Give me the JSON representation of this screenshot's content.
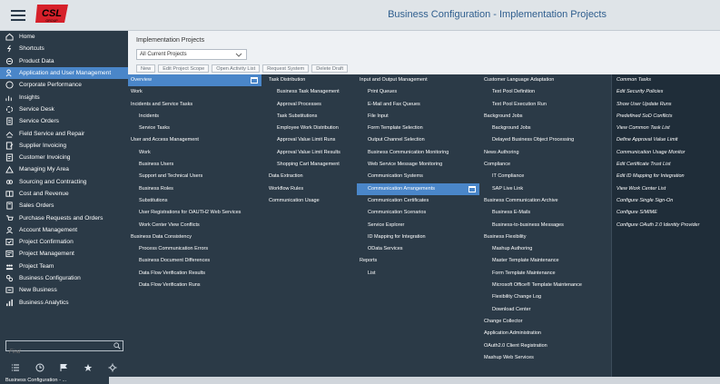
{
  "header": {
    "title": "Business Configuration - Implementation Projects",
    "logo_text": "CSL",
    "logo_sub": "GROUP"
  },
  "sidebar": {
    "items": [
      {
        "label": "Home",
        "icon": "home-icon"
      },
      {
        "label": "Shortcuts",
        "icon": "shortcut-icon"
      },
      {
        "label": "Product Data",
        "icon": "product-icon"
      },
      {
        "label": "Application and User Management",
        "icon": "user-settings-icon"
      },
      {
        "label": "Corporate Performance",
        "icon": "performance-icon"
      },
      {
        "label": "Insights",
        "icon": "insights-icon"
      },
      {
        "label": "Service Desk",
        "icon": "service-desk-icon"
      },
      {
        "label": "Service Orders",
        "icon": "service-orders-icon"
      },
      {
        "label": "Field Service and Repair",
        "icon": "field-service-icon"
      },
      {
        "label": "Supplier Invoicing",
        "icon": "supplier-invoice-icon"
      },
      {
        "label": "Customer Invoicing",
        "icon": "customer-invoice-icon"
      },
      {
        "label": "Managing My Area",
        "icon": "managing-area-icon"
      },
      {
        "label": "Sourcing and Contracting",
        "icon": "sourcing-icon"
      },
      {
        "label": "Cost and Revenue",
        "icon": "cost-revenue-icon"
      },
      {
        "label": "Sales Orders",
        "icon": "sales-orders-icon"
      },
      {
        "label": "Purchase Requests and Orders",
        "icon": "purchase-icon"
      },
      {
        "label": "Account Management",
        "icon": "account-icon"
      },
      {
        "label": "Project Confirmation",
        "icon": "project-confirmation-icon"
      },
      {
        "label": "Project Management",
        "icon": "project-management-icon"
      },
      {
        "label": "Project Team",
        "icon": "project-team-icon"
      },
      {
        "label": "Business Configuration",
        "icon": "business-config-icon"
      },
      {
        "label": "New Business",
        "icon": "new-business-icon"
      },
      {
        "label": "Business Analytics",
        "icon": "analytics-icon"
      }
    ],
    "find_placeholder": "Find",
    "bottom_icons": [
      "list-icon",
      "clock-icon",
      "flag-icon",
      "star-icon",
      "settings-icon"
    ]
  },
  "page": {
    "title": "Implementation Projects",
    "select_value": "All Current Projects",
    "toolbar": [
      "New",
      "Edit Project Scope",
      "Open Activity List",
      "Request System",
      "Delete Draft"
    ]
  },
  "menu": {
    "col1": [
      {
        "label": "Overview",
        "type": "head",
        "hl": true,
        "pop": true
      },
      {
        "label": "Work",
        "type": "head"
      },
      {
        "label": "Incidents and Service Tasks",
        "type": "head"
      },
      {
        "label": "Incidents",
        "type": "sub"
      },
      {
        "label": "Service Tasks",
        "type": "sub"
      },
      {
        "label": "User and Access Management",
        "type": "head"
      },
      {
        "label": "Work",
        "type": "sub"
      },
      {
        "label": "Business Users",
        "type": "sub"
      },
      {
        "label": "Support and Technical Users",
        "type": "sub"
      },
      {
        "label": "Business Roles",
        "type": "sub"
      },
      {
        "label": "Substitutions",
        "type": "sub"
      },
      {
        "label": "User Registrations for OAUTH2 Web Services",
        "type": "sub"
      },
      {
        "label": "Work Center View Conflicts",
        "type": "sub"
      },
      {
        "label": "Business Data Consistency",
        "type": "head"
      },
      {
        "label": "Process Communication Errors",
        "type": "sub"
      },
      {
        "label": "Business Document Differences",
        "type": "sub"
      },
      {
        "label": "Data Flow Verification Results",
        "type": "sub"
      },
      {
        "label": "Data Flow Verification Runs",
        "type": "sub"
      }
    ],
    "col2": [
      {
        "label": "Task Distribution",
        "type": "head"
      },
      {
        "label": "Business Task Management",
        "type": "sub"
      },
      {
        "label": "Approval Processes",
        "type": "sub"
      },
      {
        "label": "Task Substitutions",
        "type": "sub"
      },
      {
        "label": "Employee Work Distribution",
        "type": "sub"
      },
      {
        "label": "Approval Value Limit Runs",
        "type": "sub"
      },
      {
        "label": "Approval Value Limit Results",
        "type": "sub"
      },
      {
        "label": "Shopping Cart Management",
        "type": "sub"
      },
      {
        "label": "Data Extraction",
        "type": "head"
      },
      {
        "label": "Workflow Rules",
        "type": "head"
      },
      {
        "label": "Communication Usage",
        "type": "head"
      }
    ],
    "col3": [
      {
        "label": "Input and Output Management",
        "type": "head"
      },
      {
        "label": "Print Queues",
        "type": "sub"
      },
      {
        "label": "E-Mail and Fax Queues",
        "type": "sub"
      },
      {
        "label": "File Input",
        "type": "sub"
      },
      {
        "label": "Form Template Selection",
        "type": "sub"
      },
      {
        "label": "Output Channel Selection",
        "type": "sub"
      },
      {
        "label": "Business Communication Monitoring",
        "type": "sub"
      },
      {
        "label": "Web Service Message Monitoring",
        "type": "sub"
      },
      {
        "label": "Communication Systems",
        "type": "sub"
      },
      {
        "label": "Communication Arrangements",
        "type": "sub",
        "hl": true,
        "pop": true
      },
      {
        "label": "Communication Certificates",
        "type": "sub"
      },
      {
        "label": "Communication Scenarios",
        "type": "sub"
      },
      {
        "label": "Service Explorer",
        "type": "sub"
      },
      {
        "label": "ID Mapping for Integration",
        "type": "sub"
      },
      {
        "label": "OData Services",
        "type": "sub"
      },
      {
        "label": "Reports",
        "type": "head"
      },
      {
        "label": "List",
        "type": "sub"
      }
    ],
    "col4": [
      {
        "label": "Customer Language Adaptation",
        "type": "head"
      },
      {
        "label": "Text Pool Definition",
        "type": "sub"
      },
      {
        "label": "Text Pool Execution Run",
        "type": "sub"
      },
      {
        "label": "Background Jobs",
        "type": "head"
      },
      {
        "label": "Background Jobs",
        "type": "sub"
      },
      {
        "label": "Delayed Business Object Processing",
        "type": "sub"
      },
      {
        "label": "News Authoring",
        "type": "head"
      },
      {
        "label": "Compliance",
        "type": "head"
      },
      {
        "label": "IT Compliance",
        "type": "sub"
      },
      {
        "label": "SAP Live Link",
        "type": "sub"
      },
      {
        "label": "Business Communication Archive",
        "type": "head"
      },
      {
        "label": "Business E-Mails",
        "type": "sub"
      },
      {
        "label": "Business-to-business Messages",
        "type": "sub"
      },
      {
        "label": "Business Flexibility",
        "type": "head"
      },
      {
        "label": "Mashup Authoring",
        "type": "sub"
      },
      {
        "label": "Master Template Maintenance",
        "type": "sub"
      },
      {
        "label": "Form Template Maintenance",
        "type": "sub"
      },
      {
        "label": "Microsoft Office® Template Maintenance",
        "type": "sub"
      },
      {
        "label": "Flexibility Change Log",
        "type": "sub"
      },
      {
        "label": "Download Center",
        "type": "sub"
      },
      {
        "label": "Change Collector",
        "type": "head"
      },
      {
        "label": "Application Administration",
        "type": "head"
      },
      {
        "label": "OAuth2.0 Client Registration",
        "type": "head"
      },
      {
        "label": "Mashup Web Services",
        "type": "head"
      }
    ],
    "common_tasks": [
      "Common Tasks",
      "Edit Security Policies",
      "Show User Update Runs",
      "Predefined SoD Conflicts",
      "View Common Task List",
      "Define Approval Value Limit",
      "Communication Usage Monitor",
      "Edit Certificate Trust List",
      "Edit ID Mapping for Integration",
      "View Work Center List",
      "Configure Single Sign-On",
      "Configure S/MIME",
      "Configure OAuth 2.0 Identity Provider"
    ]
  },
  "status": {
    "text": "Business Configuration - ..."
  },
  "colors": {
    "sidebar_bg": "#2b3a47",
    "highlight": "#4a86c9",
    "header_bg": "#dfe4e8",
    "logo_red": "#d6202a"
  }
}
